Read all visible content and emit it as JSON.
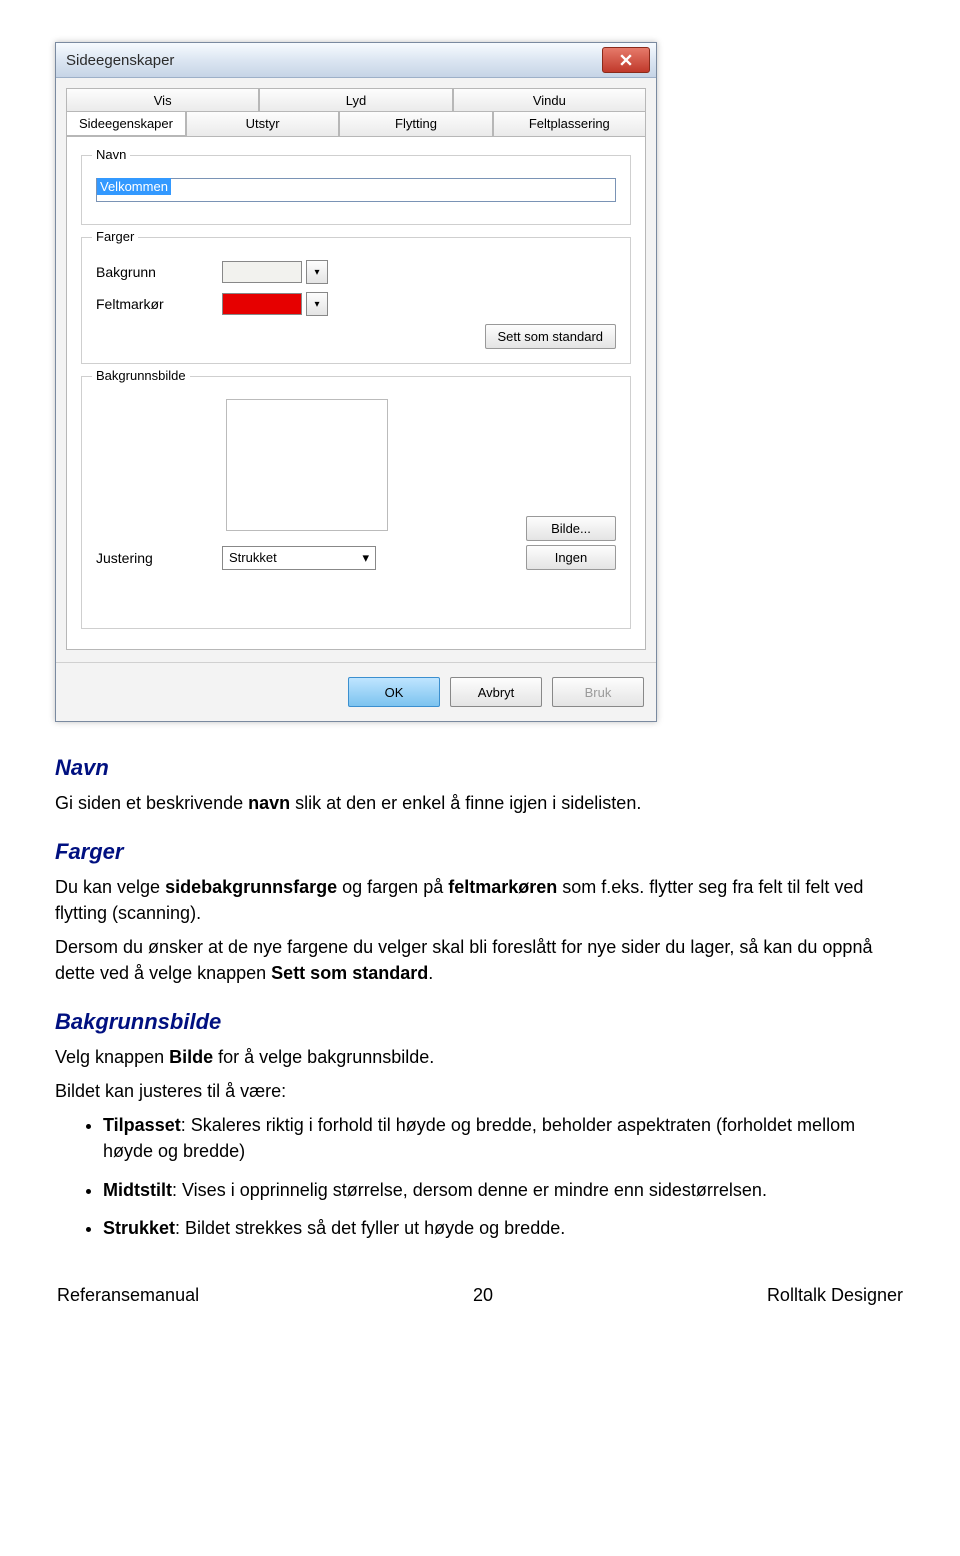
{
  "dialog": {
    "title": "Sideegenskaper",
    "tabs_row1": [
      "Vis",
      "Lyd",
      "Vindu"
    ],
    "tabs_row2": [
      "Sideegenskaper",
      "Utstyr",
      "Flytting",
      "Feltplassering"
    ],
    "groups": {
      "navn": {
        "legend": "Navn",
        "value": "Velkommen"
      },
      "farger": {
        "legend": "Farger",
        "bakgrunn_label": "Bakgrunn",
        "feltmarkor_label": "Feltmarkør",
        "bakgrunn_color": "#f2f2ee",
        "feltmarkor_color": "#e60000",
        "set_default": "Sett som standard"
      },
      "bakgrunnsbilde": {
        "legend": "Bakgrunnsbilde",
        "justering_label": "Justering",
        "justering_value": "Strukket",
        "bilde_btn": "Bilde...",
        "ingen_btn": "Ingen"
      }
    },
    "footer": {
      "ok": "OK",
      "avbryt": "Avbryt",
      "bruk": "Bruk"
    }
  },
  "doc": {
    "navn": {
      "heading": "Navn",
      "p1a": "Gi siden et beskrivende ",
      "p1b": "navn",
      "p1c": " slik at den er enkel å finne igjen i sidelisten."
    },
    "farger": {
      "heading": "Farger",
      "p1a": "Du kan velge ",
      "p1b": "sidebakgrunnsfarge",
      "p1c": " og fargen på ",
      "p1d": "feltmarkøren",
      "p1e": " som f.eks. flytter seg fra felt til felt ved flytting (scanning).",
      "p2a": "Dersom du ønsker at de nye fargene du velger skal bli foreslått for nye sider du lager, så kan du oppnå dette ved å velge knappen ",
      "p2b": "Sett som standard",
      "p2c": "."
    },
    "bakgrunnsbilde": {
      "heading": "Bakgrunnsbilde",
      "p1a": "Velg knappen ",
      "p1b": "Bilde",
      "p1c": " for å velge bakgrunnsbilde.",
      "p2": "Bildet kan justeres til å være:",
      "li1": {
        "b": "Tilpasset",
        "t": ": Skaleres riktig i forhold til høyde og bredde, beholder aspektraten (forholdet mellom høyde og bredde)"
      },
      "li2": {
        "b": "Midtstilt",
        "t": ": Vises i opprinnelig størrelse, dersom denne er mindre enn sidestørrelsen."
      },
      "li3": {
        "b": "Strukket",
        "t": ": Bildet strekkes så det fyller ut høyde og bredde."
      }
    },
    "footer": {
      "left": "Referansemanual",
      "center": "20",
      "right": "Rolltalk Designer"
    }
  }
}
